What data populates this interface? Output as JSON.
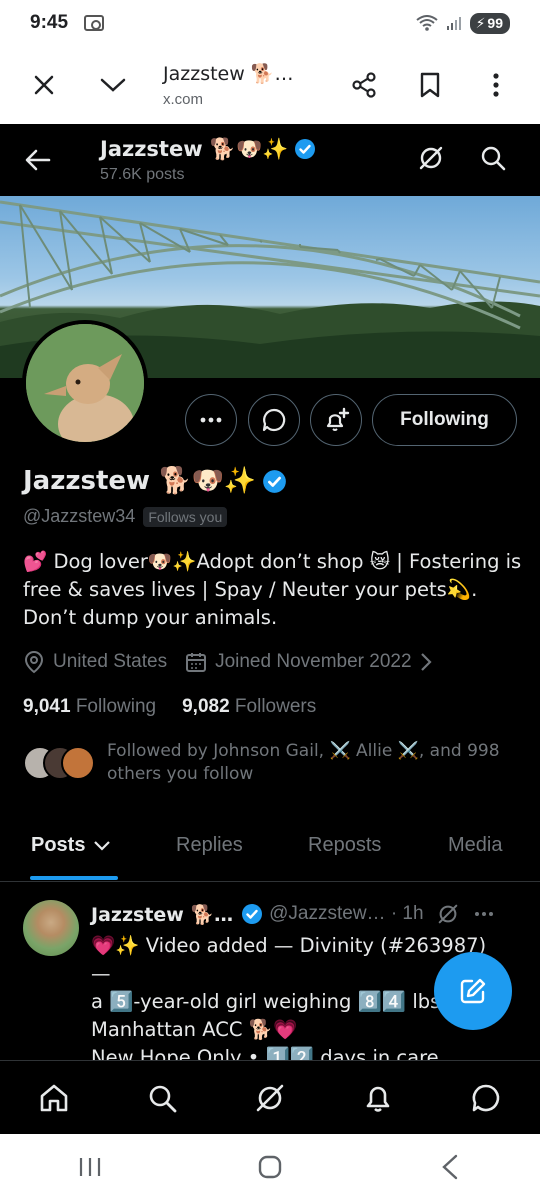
{
  "status": {
    "time": "9:45",
    "battery": "99"
  },
  "browser": {
    "title": "Jazzstew 🐕…",
    "url": "x.com"
  },
  "header": {
    "name": "Jazzstew 🐕🐶✨",
    "posts": "57.6K posts"
  },
  "profile": {
    "name": "Jazzstew 🐕🐶✨",
    "handle": "@Jazzstew34",
    "follows_you": "Follows you",
    "follow_button": "Following",
    "bio": "💕 Dog lover🐶✨Adopt don’t shop 😿 | Fostering is free & saves lives | Spay / Neuter your pets💫. Don’t dump your animals.",
    "location": "United States",
    "joined": "Joined November 2022",
    "following_count": "9,041",
    "following_label": "Following",
    "followers_count": "9,082",
    "followers_label": "Followers",
    "followed_by": "Followed by Johnson Gail, ⚔️ Allie ⚔️, and 998 others you follow"
  },
  "tabs": [
    {
      "label": "Posts"
    },
    {
      "label": "Replies"
    },
    {
      "label": "Reposts"
    },
    {
      "label": "Media"
    }
  ],
  "post": {
    "name": "Jazzstew 🐕…",
    "handle": "@Jazzstew… · 1h",
    "body_line1": "💗✨ Video added — Divinity (#263987) —",
    "body_line2": "a 5️⃣-year-old girl weighing 8️⃣4️⃣ lbs",
    "body_line3": "Manhattan ACC 🐕💗",
    "body_line4": "New Hope Only • 1️⃣2️⃣ days in care"
  },
  "colors": {
    "accent": "#1d9bf0",
    "background": "#000000",
    "muted": "#71767b"
  },
  "icons": [
    "close-icon",
    "chevron-down-icon",
    "share-icon",
    "bookmark-icon",
    "more-icon",
    "back-icon",
    "grok-icon",
    "search-icon",
    "location-icon",
    "calendar-icon",
    "chevron-right-icon",
    "compose-icon",
    "home-icon",
    "bell-icon",
    "messages-icon"
  ]
}
